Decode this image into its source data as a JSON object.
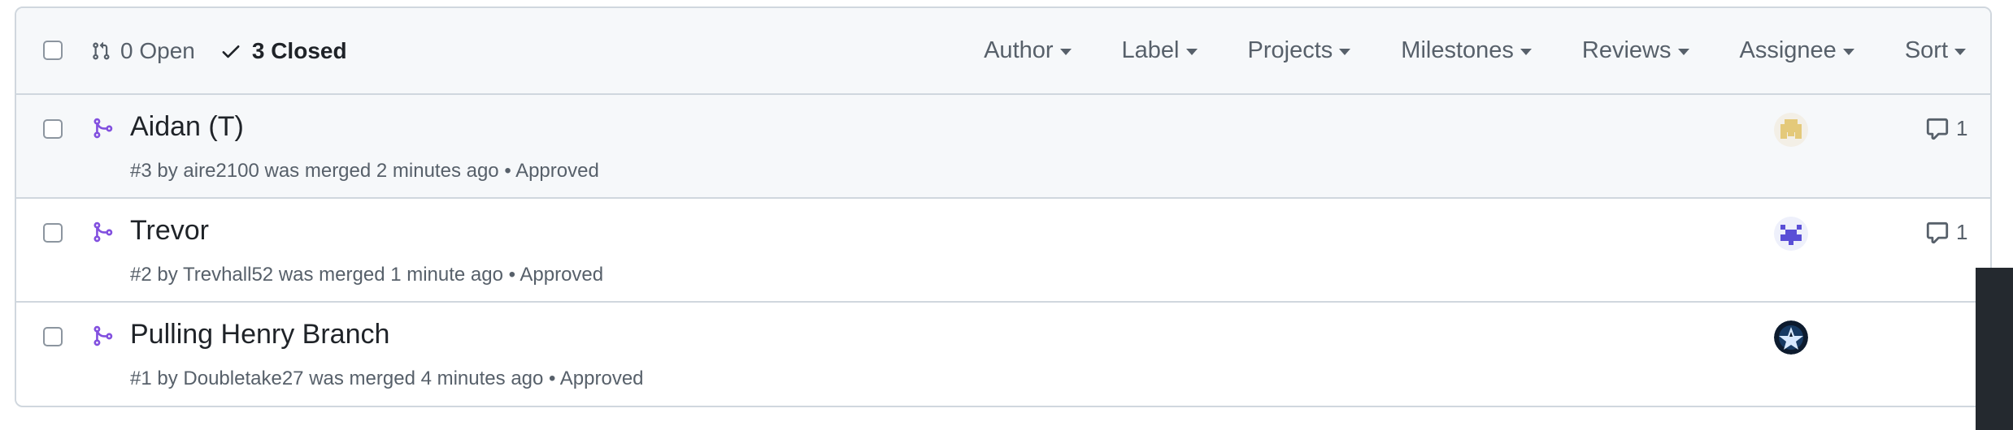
{
  "header": {
    "open_label": "0 Open",
    "closed_label": "3 Closed",
    "filters": [
      "Author",
      "Label",
      "Projects",
      "Milestones",
      "Reviews",
      "Assignee",
      "Sort"
    ]
  },
  "pull_requests": [
    {
      "title": "Aidan (T)",
      "number": "#3",
      "by": "by",
      "author": "aire2100",
      "merged_text": "was merged 2 minutes ago",
      "review": "• Approved",
      "comment_count": "1",
      "avatar": "yellow-pixel-avatar"
    },
    {
      "title": "Trevor",
      "number": "#2",
      "by": "by",
      "author": "Trevhall52",
      "merged_text": "was merged 1 minute ago",
      "review": "• Approved",
      "comment_count": "1",
      "avatar": "blue-pixel-avatar"
    },
    {
      "title": "Pulling Henry Branch",
      "number": "#1",
      "by": "by",
      "author": "Doubletake27",
      "merged_text": "was merged 4 minutes ago",
      "review": "• Approved",
      "comment_count": "",
      "avatar": "dark-star-avatar"
    }
  ],
  "colors": {
    "merged_purple": "#8250df",
    "border": "#d0d7de",
    "muted_text": "#57606a",
    "header_bg": "#f6f8fa"
  }
}
